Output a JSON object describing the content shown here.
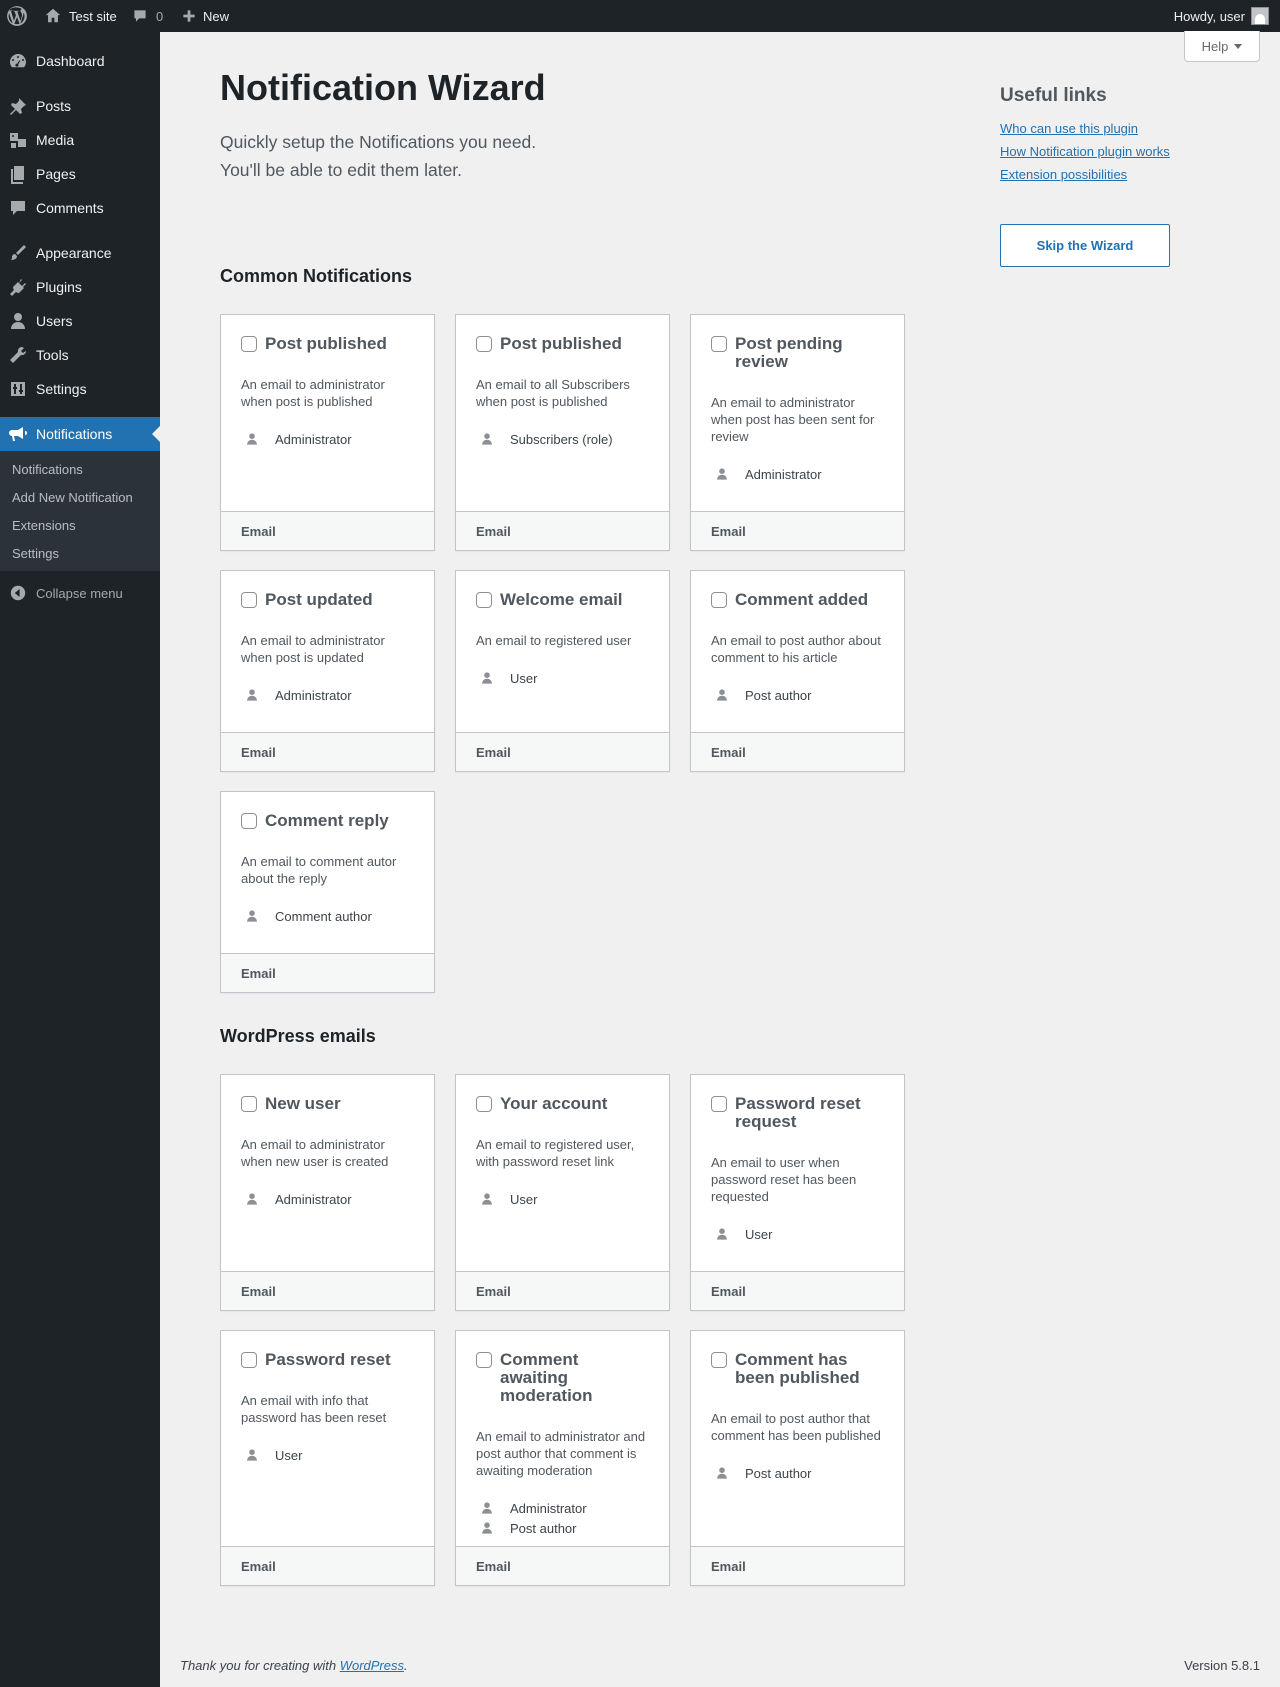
{
  "adminbar": {
    "site_name": "Test site",
    "comments_count": "0",
    "new_label": "New",
    "howdy": "Howdy, user"
  },
  "sidebar": {
    "items": [
      {
        "label": "Dashboard",
        "icon": "dashboard-icon"
      },
      {
        "label": "Posts",
        "icon": "pin-icon"
      },
      {
        "label": "Media",
        "icon": "media-icon"
      },
      {
        "label": "Pages",
        "icon": "pages-icon"
      },
      {
        "label": "Comments",
        "icon": "comment-icon"
      },
      {
        "label": "Appearance",
        "icon": "brush-icon"
      },
      {
        "label": "Plugins",
        "icon": "plugin-icon"
      },
      {
        "label": "Users",
        "icon": "user-icon"
      },
      {
        "label": "Tools",
        "icon": "wrench-icon"
      },
      {
        "label": "Settings",
        "icon": "settings-icon"
      },
      {
        "label": "Notifications",
        "icon": "megaphone-icon"
      }
    ],
    "submenu": [
      "Notifications",
      "Add New Notification",
      "Extensions",
      "Settings"
    ],
    "collapse": "Collapse menu"
  },
  "help_tab": "Help",
  "header": {
    "title": "Notification Wizard",
    "intro_line1": "Quickly setup the Notifications you need.",
    "intro_line2": "You'll be able to edit them later."
  },
  "useful_links": {
    "title": "Useful links",
    "links": [
      "Who can use this plugin",
      "How Notification plugin works",
      "Extension possibilities"
    ],
    "skip_button": "Skip the Wizard"
  },
  "sections": [
    {
      "title": "Common Notifications",
      "cards": [
        {
          "title": "Post published",
          "description": "An email to administrator when post is published",
          "recipients": [
            "Administrator"
          ],
          "carrier": "Email"
        },
        {
          "title": "Post published",
          "description": "An email to all Subscribers when post is published",
          "recipients": [
            "Subscribers (role)"
          ],
          "carrier": "Email"
        },
        {
          "title": "Post pending review",
          "description": "An email to administrator when post has been sent for review",
          "recipients": [
            "Administrator"
          ],
          "carrier": "Email"
        },
        {
          "title": "Post updated",
          "description": "An email to administrator when post is updated",
          "recipients": [
            "Administrator"
          ],
          "carrier": "Email"
        },
        {
          "title": "Welcome email",
          "description": "An email to registered user",
          "recipients": [
            "User"
          ],
          "carrier": "Email"
        },
        {
          "title": "Comment added",
          "description": "An email to post author about comment to his article",
          "recipients": [
            "Post author"
          ],
          "carrier": "Email"
        },
        {
          "title": "Comment reply",
          "description": "An email to comment autor about the reply",
          "recipients": [
            "Comment author"
          ],
          "carrier": "Email"
        }
      ]
    },
    {
      "title": "WordPress emails",
      "cards": [
        {
          "title": "New user",
          "description": "An email to administrator when new user is created",
          "recipients": [
            "Administrator"
          ],
          "carrier": "Email"
        },
        {
          "title": "Your account",
          "description": "An email to registered user, with password reset link",
          "recipients": [
            "User"
          ],
          "carrier": "Email"
        },
        {
          "title": "Password reset request",
          "description": "An email to user when password reset has been requested",
          "recipients": [
            "User"
          ],
          "carrier": "Email"
        },
        {
          "title": "Password reset",
          "description": "An email with info that password has been reset",
          "recipients": [
            "User"
          ],
          "carrier": "Email"
        },
        {
          "title": "Comment awaiting moderation",
          "description": "An email to administrator and post author that comment is awaiting moderation",
          "recipients": [
            "Administrator",
            "Post author"
          ],
          "carrier": "Email"
        },
        {
          "title": "Comment has been published",
          "description": "An email to post author that comment has been published",
          "recipients": [
            "Post author"
          ],
          "carrier": "Email"
        }
      ]
    }
  ],
  "footer": {
    "text_before": "Thank you for creating with ",
    "link": "WordPress",
    "text_after": ".",
    "version": "Version 5.8.1"
  },
  "colors": {
    "accent": "#2271b1",
    "sidebar": "#1d2327",
    "background": "#f0f0f1"
  }
}
